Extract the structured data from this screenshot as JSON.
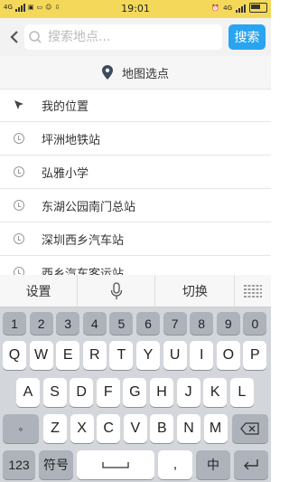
{
  "status_bar": {
    "network": "4G",
    "time": "19:01",
    "network_right": "4G"
  },
  "search": {
    "placeholder": "搜索地点...",
    "button_label": "搜索"
  },
  "map_select": {
    "label": "地图选点"
  },
  "list": [
    {
      "label": "我的位置",
      "icon": "location-arrow-icon"
    },
    {
      "label": "坪洲地铁站",
      "icon": "clock-icon"
    },
    {
      "label": "弘雅小学",
      "icon": "clock-icon"
    },
    {
      "label": "东湖公园南门总站",
      "icon": "clock-icon"
    },
    {
      "label": "深圳西乡汽车站",
      "icon": "clock-icon"
    },
    {
      "label": "西乡汽车客运站",
      "icon": "clock-icon"
    }
  ],
  "keyboard": {
    "toolbar": {
      "settings": "设置",
      "switch": "切换"
    },
    "number_row": [
      "1",
      "2",
      "3",
      "4",
      "5",
      "6",
      "7",
      "8",
      "9",
      "0"
    ],
    "row1": [
      "Q",
      "W",
      "E",
      "R",
      "T",
      "Y",
      "U",
      "I",
      "O",
      "P"
    ],
    "row2": [
      "A",
      "S",
      "D",
      "F",
      "G",
      "H",
      "J",
      "K",
      "L"
    ],
    "row3": [
      "Z",
      "X",
      "C",
      "V",
      "B",
      "N",
      "M"
    ],
    "symbol_key": "◦",
    "key_123": "123",
    "key_symbols": "符号",
    "key_comma": ",",
    "key_lang": "中"
  }
}
